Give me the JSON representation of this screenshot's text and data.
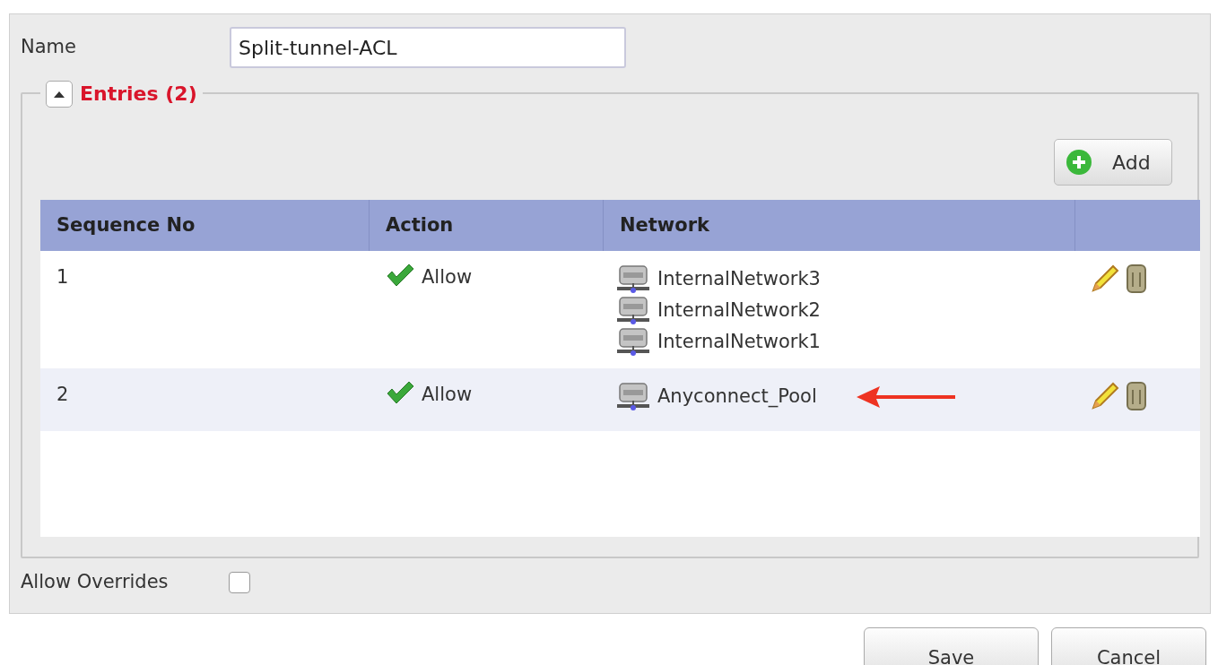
{
  "name_field": {
    "label": "Name",
    "value": "Split-tunnel-ACL"
  },
  "entries": {
    "title": "Entries (2)",
    "expanded": true,
    "add_button": "Add",
    "columns": [
      "Sequence No",
      "Action",
      "Network"
    ],
    "rows": [
      {
        "sequence": "1",
        "action": "Allow",
        "networks": [
          "InternalNetwork3",
          "InternalNetwork2",
          "InternalNetwork1"
        ],
        "annotated": false
      },
      {
        "sequence": "2",
        "action": "Allow",
        "networks": [
          "Anyconnect_Pool"
        ],
        "annotated": true
      }
    ]
  },
  "allow_overrides": {
    "label": "Allow Overrides",
    "checked": false
  },
  "buttons": [
    "Save",
    "Cancel"
  ]
}
